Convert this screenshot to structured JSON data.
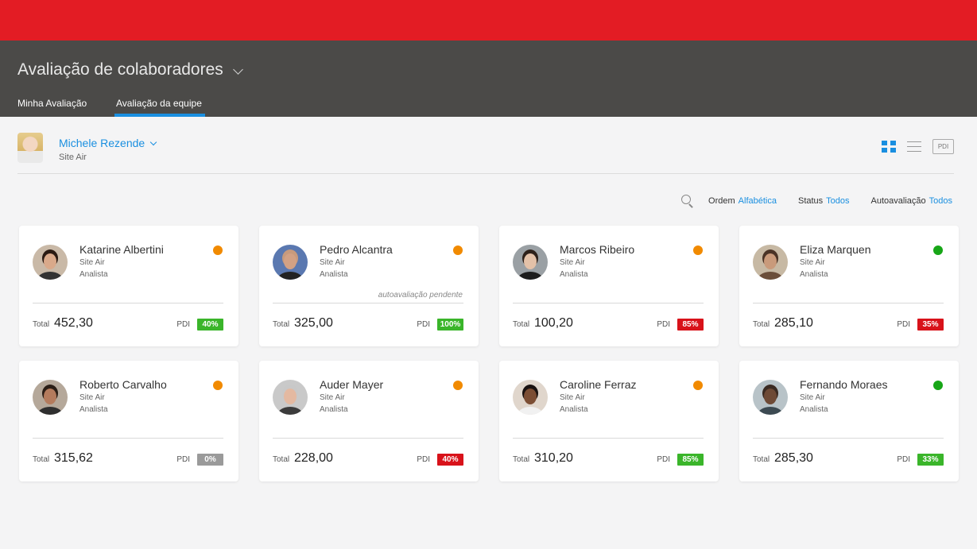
{
  "header": {
    "title": "Avaliação de colaboradores",
    "tabs": [
      {
        "label": "Minha Avaliação",
        "active": false
      },
      {
        "label": "Avaliação da equipe",
        "active": true
      }
    ]
  },
  "user": {
    "name": "Michele Rezende",
    "site": "Site Air"
  },
  "view": {
    "pdi_label": "PDI"
  },
  "filters": {
    "order_label": "Ordem",
    "order_value": "Alfabética",
    "status_label": "Status",
    "status_value": "Todos",
    "self_label": "Autoavaliação",
    "self_value": "Todos"
  },
  "card_labels": {
    "total": "Total",
    "pdi": "PDI"
  },
  "colors": {
    "accent": "#1a8fe0",
    "brand_red": "#e31c24",
    "header_bg": "#4b4a48",
    "dot_orange": "#f18a00",
    "dot_green": "#17a617",
    "badge_green": "#3ab52a",
    "badge_red": "#d8121a",
    "badge_gray": "#9a9a9a"
  },
  "cards": [
    {
      "name": "Katarine Albertini",
      "site": "Site Air",
      "role": "Analista",
      "status": "orange",
      "note": "",
      "total": "452,30",
      "pdi": "40%",
      "pdi_color": "green",
      "avatar": "woman-dark-hair"
    },
    {
      "name": "Pedro Alcantra",
      "site": "Site Air",
      "role": "Analista",
      "status": "orange",
      "note": "autoavaliação pendente",
      "total": "325,00",
      "pdi": "100%",
      "pdi_color": "green",
      "avatar": "man-bald-glasses"
    },
    {
      "name": "Marcos Ribeiro",
      "site": "Site Air",
      "role": "Analista",
      "status": "orange",
      "note": "",
      "total": "100,20",
      "pdi": "85%",
      "pdi_color": "red",
      "avatar": "man-curly-beard"
    },
    {
      "name": "Eliza Marquen",
      "site": "Site Air",
      "role": "Analista",
      "status": "green",
      "note": "",
      "total": "285,10",
      "pdi": "35%",
      "pdi_color": "red",
      "avatar": "woman-scarf"
    },
    {
      "name": "Roberto Carvalho",
      "site": "Site Air",
      "role": "Analista",
      "status": "orange",
      "note": "",
      "total": "315,62",
      "pdi": "0%",
      "pdi_color": "gray",
      "avatar": "man-smiling"
    },
    {
      "name": "Auder Mayer",
      "site": "Site Air",
      "role": "Analista",
      "status": "orange",
      "note": "",
      "total": "228,00",
      "pdi": "40%",
      "pdi_color": "red",
      "avatar": "man-gray-hair-glasses"
    },
    {
      "name": "Caroline Ferraz",
      "site": "Site Air",
      "role": "Analista",
      "status": "orange",
      "note": "",
      "total": "310,20",
      "pdi": "85%",
      "pdi_color": "green",
      "avatar": "woman-curly-hair"
    },
    {
      "name": "Fernando Moraes",
      "site": "Site Air",
      "role": "Analista",
      "status": "green",
      "note": "",
      "total": "285,30",
      "pdi": "33%",
      "pdi_color": "green",
      "avatar": "man-suit"
    }
  ]
}
